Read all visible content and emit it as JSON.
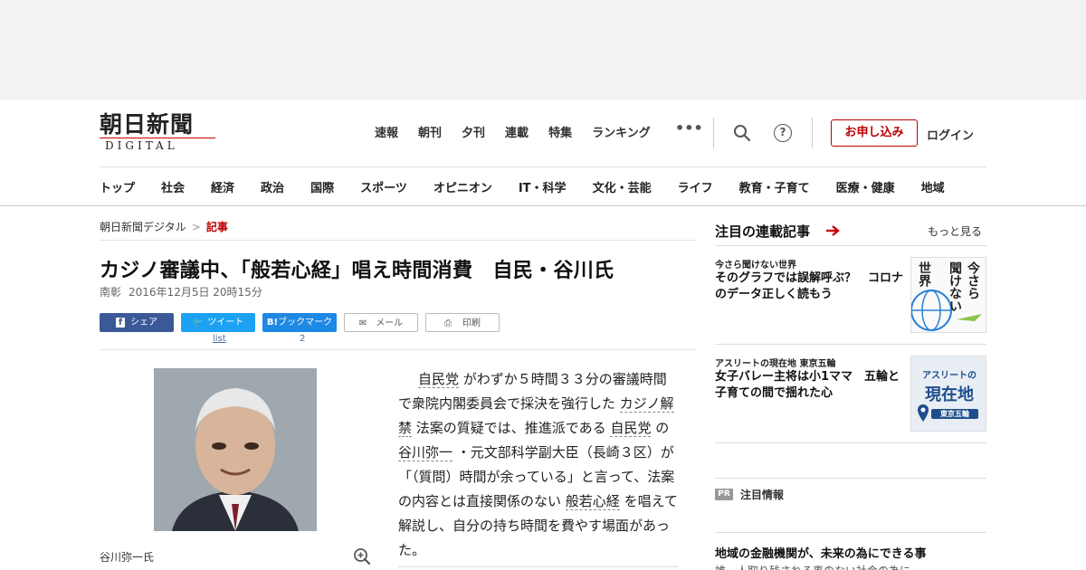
{
  "header": {
    "logo_jp": "朝日新聞",
    "logo_en": "DIGITAL",
    "top_nav": [
      "速報",
      "朝刊",
      "夕刊",
      "連載",
      "特集",
      "ランキング"
    ],
    "more_label": "•••",
    "help_label": "?",
    "apply_label": "お申し込み",
    "login_label": "ログイン"
  },
  "section_nav": [
    "トップ",
    "社会",
    "経済",
    "政治",
    "国際",
    "スポーツ",
    "オピニオン",
    "IT・科学",
    "文化・芸能",
    "ライフ",
    "教育・子育て",
    "医療・健康",
    "地域"
  ],
  "breadcrumb": {
    "home": "朝日新聞デジタル",
    "separator": ">",
    "current": "記事"
  },
  "article": {
    "headline": "カジノ審議中、「般若心経」唱え時間消費　自民・谷川氏",
    "author": "南彰",
    "date": "2016年12月5日 20時15分",
    "share": {
      "facebook": "シェア",
      "twitter": "ツイート",
      "hatena": "ブックマーク",
      "mail": "メール",
      "print": "印刷",
      "twitter_count": "list",
      "hatena_count": "2"
    },
    "photo_caption": "谷川弥一氏",
    "body": {
      "p1": "自民党",
      "p2": "がわずか５時間３３分の審議時間で衆院内閣委員会で採決を強行した",
      "p3": "カジノ解禁",
      "p4": "法案の質疑では、推進派である",
      "p5": "自民党",
      "p6": "の",
      "p7": "谷川弥一",
      "p8": "・元文部科学副大臣（長崎３区）が「（質問）時間が余っている」と言って、法案の内容とは直接関係のない",
      "p9": "般若心経",
      "p10": "を唱えて解説し、自分の持ち時間を費やす場面があった。"
    }
  },
  "sidebar": {
    "title": "注目の連載記事",
    "more": "もっと見る",
    "items": [
      {
        "category": "今さら聞けない世界",
        "title": "そのグラフでは誤解呼ぶ？　コロナのデータ正しく読もう",
        "thumb_text": [
          "今さら",
          "聞けない",
          "世界"
        ]
      },
      {
        "category": "アスリートの現在地 東京五輪",
        "title": "女子バレー主将は小1ママ　五輪と子育ての間で揺れた心",
        "thumb_text": [
          "アスリートの",
          "現在地",
          "東京五輪"
        ]
      }
    ],
    "pr_tag": "PR",
    "pr_label": "注目情報",
    "pr_headline": "地域の金融機関が、未来の為にできる事",
    "pr_sub": "誰一人取り残される事のない社会の為に"
  },
  "colors": {
    "brand_red": "#b00000",
    "facebook": "#3b5998",
    "twitter": "#1da1f2",
    "hatena": "#1e88e5"
  }
}
